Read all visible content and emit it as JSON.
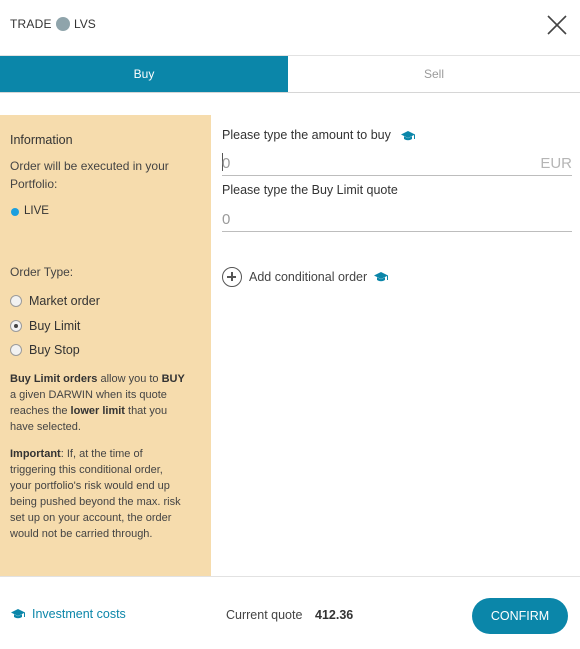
{
  "header": {
    "trade_label": "TRADE",
    "symbol": "LVS",
    "close_icon": "close-icon"
  },
  "tabs": [
    {
      "label": "Buy",
      "active": true
    },
    {
      "label": "Sell",
      "active": false
    }
  ],
  "sidebar": {
    "info_title": "Information",
    "info_text": "Order will be executed in your Portfolio:",
    "portfolio": "LIVE",
    "order_type_label": "Order Type:",
    "order_types": [
      {
        "label": "Market order",
        "checked": false
      },
      {
        "label": "Buy Limit",
        "checked": true
      },
      {
        "label": "Buy Stop",
        "checked": false
      }
    ],
    "desc1": {
      "p1": "Buy Limit orders",
      "p2": " allow you to ",
      "p3": "BUY",
      "p4": " a given DARWIN when its quote reaches the ",
      "p5": "lower limit",
      "p6": " that you have selected."
    },
    "desc2": {
      "p1": "Important",
      "p2": ": If, at the time of triggering this conditional order, your portfolio's risk would end up being pushed beyond the max. risk set up on your account, the order would not be carried through."
    }
  },
  "main": {
    "amount_label": "Please type the amount to buy",
    "amount_value": "0",
    "currency": "EUR",
    "limit_label": "Please type the Buy Limit quote",
    "limit_value": "0",
    "conditional_label": "Add conditional order"
  },
  "footer": {
    "investment_costs": "Investment costs",
    "current_quote_label": "Current quote",
    "current_quote_value": "412.36",
    "confirm_label": "CONFIRM"
  },
  "colors": {
    "accent": "#0b86a9",
    "sidebar_bg": "#f6dcad",
    "live_dot": "#1c9fde"
  }
}
